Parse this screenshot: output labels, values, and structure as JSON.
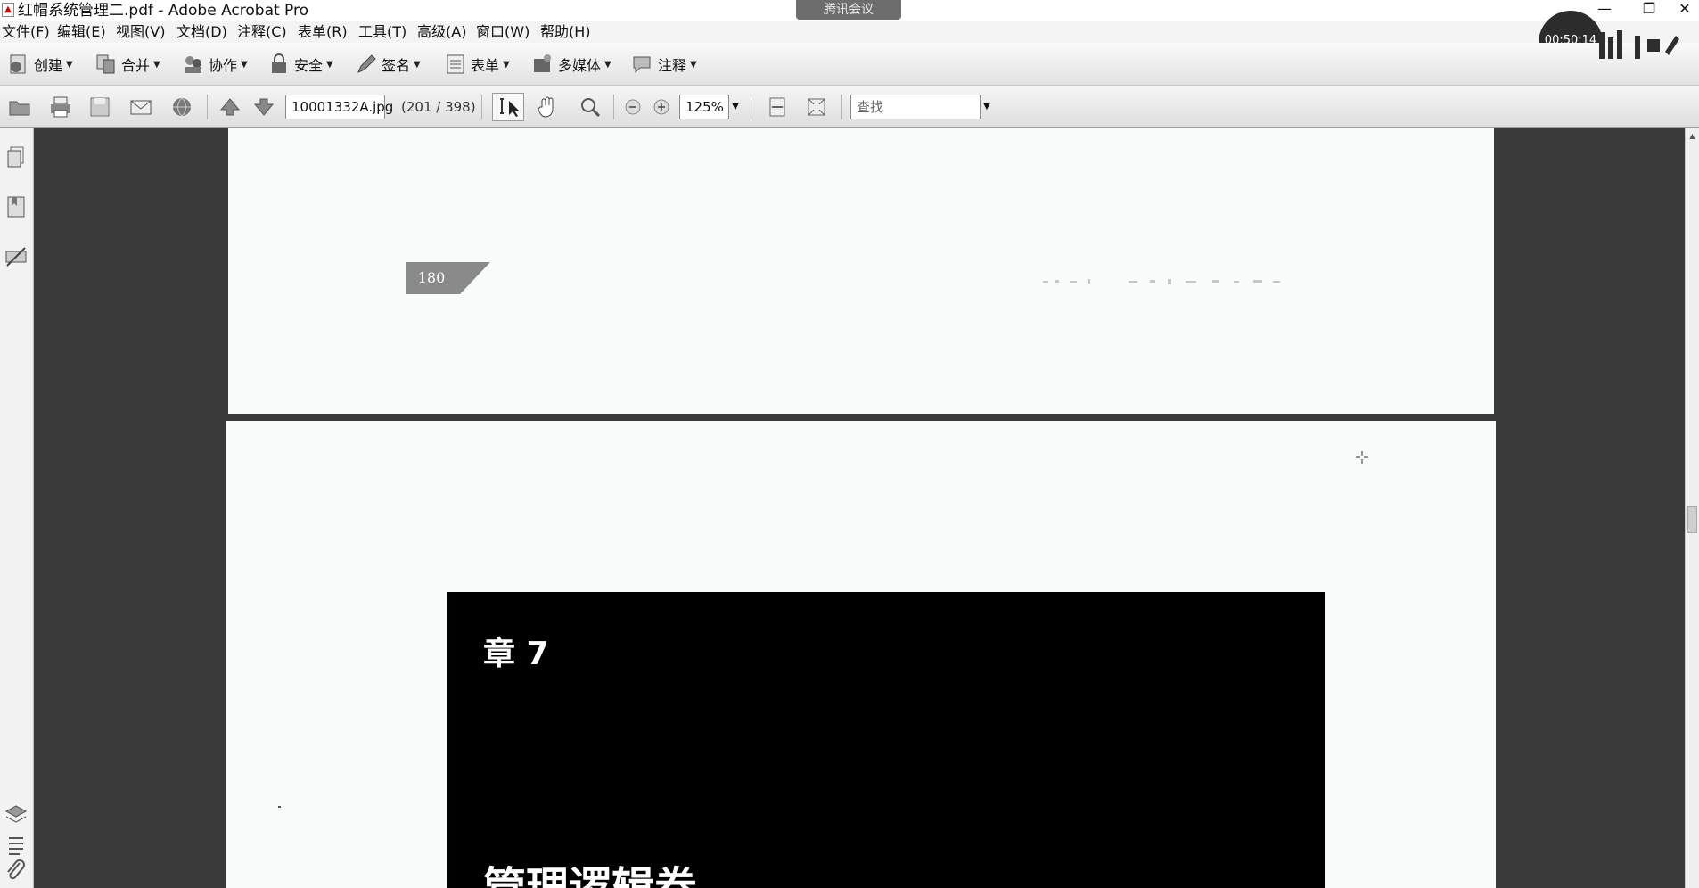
{
  "window": {
    "title": "红帽系统管理二.pdf - Adobe Acrobat Pro",
    "meeting_tab": "腾讯会议",
    "minimize": "—",
    "restore": "❐",
    "close": "✕"
  },
  "menubar": {
    "items": [
      "文件(F)",
      "编辑(E)",
      "视图(V)",
      "文档(D)",
      "注释(C)",
      "表单(R)",
      "工具(T)",
      "高级(A)",
      "窗口(W)",
      "帮助(H)"
    ]
  },
  "recording": {
    "time": "00:50:14"
  },
  "toolbar": {
    "create": "创建",
    "combine": "合并",
    "collaborate": "协作",
    "secure": "安全",
    "sign": "签名",
    "forms": "表单",
    "multimedia": "多媒体",
    "comment": "注释"
  },
  "nav": {
    "file_name": "10001332A.jpg",
    "page_count": "(201 / 398)",
    "zoom": "125%",
    "search_placeholder": "查找"
  },
  "document": {
    "page_number": "180",
    "chapter_label": "章 7",
    "chapter_title": "管理逻辑卷"
  },
  "colors": {
    "page_tag": "#8a8a8a",
    "page_bg": "#f9fafa",
    "doc_bg": "#3a3a3a",
    "chapter_bg": "#000000"
  }
}
